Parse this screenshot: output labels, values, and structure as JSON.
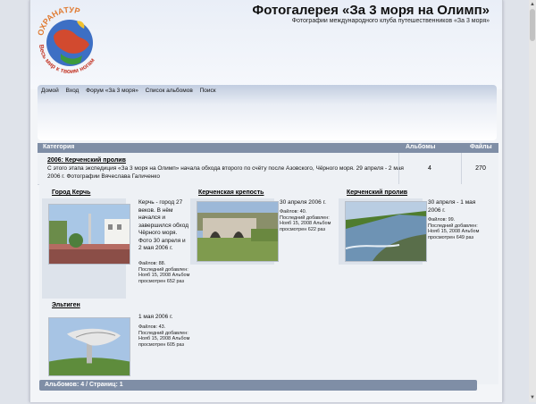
{
  "site": {
    "title": "Фотогалерея «За 3 моря на Олимп»",
    "subtitle": "Фотографии международного клуба путешественников «За 3 моря»",
    "logo_text_top": "ОХРАНАТУР",
    "logo_text_bottom": "Весь мир к твоим ногам"
  },
  "nav": {
    "items": [
      {
        "label": "Домой"
      },
      {
        "label": "Вход"
      },
      {
        "label": "Форум «За 3 моря»"
      },
      {
        "label": "Список альбомов"
      },
      {
        "label": "Поиск"
      }
    ]
  },
  "category_table": {
    "col_category": "Категория",
    "col_albums": "Альбомы",
    "col_files": "Файлы",
    "row": {
      "title": "2006: Керченский пролив",
      "description": "С этого этапа экспедиция «За 3 моря на Олимп» начала обхода второго по счёту после Азовского, Чёрного моря. 29 апреля - 2 мая 2006 г. Фотографии Вячеслава Галиченко",
      "albums": "4",
      "files": "270"
    }
  },
  "albums": [
    {
      "title": "Город Керчь",
      "description": "Керчь - город 27 веков. В нём начался и завершился обход Чёрного моря. Фото 30 апреля и 2 мая 2006 г.",
      "info": "Файлов: 88. Последний добавлен: Нояб 15, 2008 Альбом просмотрен 652 раз"
    },
    {
      "title": "Керченская крепость",
      "description": "30 апреля 2006 г.",
      "info": "Файлов: 40. Последний добавлен: Нояб 15, 2008 Альбом просмотрен 622 раз"
    },
    {
      "title": "Керченский пролив",
      "description": "30 апреля - 1 мая 2006 г.",
      "info": "Файлов: 99. Последний добавлен: Нояб 15, 2008 Альбом просмотрен 649 раз"
    },
    {
      "title": "Эльтиген",
      "description": "1 мая 2006 г.",
      "info": "Файлов: 43. Последний добавлен: Нояб 15, 2008 Альбом просмотрен 605 раз"
    }
  ],
  "footer": {
    "albums_summary": "Альбомов: 4 / Страниц: 1"
  },
  "scrollbar": {
    "up_icon": "arrow-up-icon",
    "down_icon": "arrow-down-icon"
  }
}
